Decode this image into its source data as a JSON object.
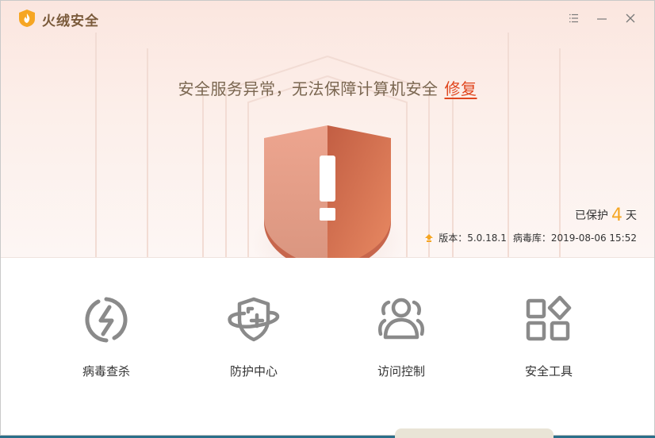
{
  "app": {
    "title": "火绒安全"
  },
  "window_controls": {
    "menu_icon": "menu-icon",
    "minimize_icon": "minimize-icon",
    "close_icon": "close-icon"
  },
  "status": {
    "message": "安全服务异常，无法保障计算机安全",
    "repair_label": "修复"
  },
  "protection": {
    "prefix": "已保护",
    "days": "4",
    "suffix": "天"
  },
  "version": {
    "version_label": "版本：",
    "version_value": "5.0.18.1",
    "db_label": "病毒库：",
    "db_value": "2019-08-06 15:52"
  },
  "features": [
    {
      "label": "病毒查杀",
      "icon": "lightning-circle-icon"
    },
    {
      "label": "防护中心",
      "icon": "shield-plus-icon"
    },
    {
      "label": "访问控制",
      "icon": "users-icon"
    },
    {
      "label": "安全工具",
      "icon": "grid-tools-icon"
    }
  ],
  "colors": {
    "accent": "#e0461e",
    "brand_title": "#7a5a3a",
    "days_number": "#f5a623",
    "shield_light": "#eea48e",
    "shield_dark": "#c96a4e",
    "icon_gray": "#8a8a8a"
  }
}
